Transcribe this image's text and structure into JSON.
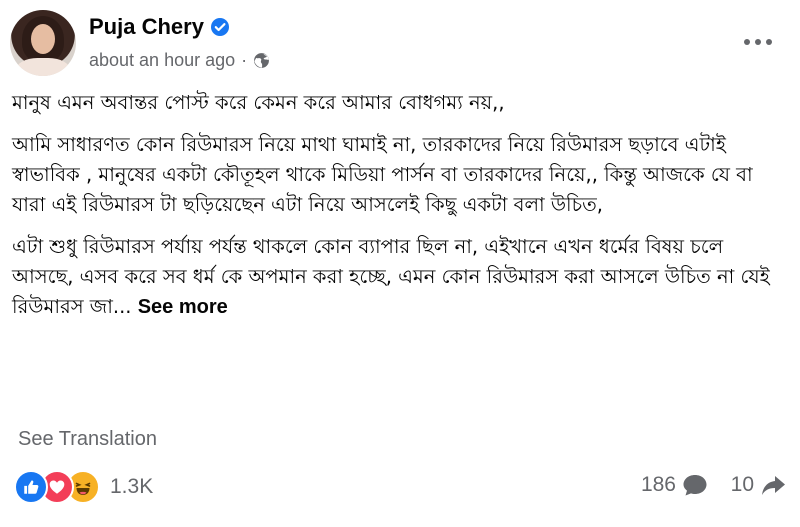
{
  "post": {
    "author": "Puja Chery",
    "timestamp": "about an hour ago",
    "separator": "·",
    "paragraphs": [
      "মানুষ এমন অবান্তর পোস্ট করে কেমন করে আমার বোধগম্য নয়,,",
      "আমি সাধারণত কোন রিউমারস নিয়ে মাথা ঘামাই না, তারকাদের নিয়ে রিউমারস ছড়াবে এটাই স্বাভাবিক , মানুষের একটা কৌতূহল থাকে মিডিয়া পার্সন বা তারকাদের নিয়ে,, কিন্তু আজকে যে বা যারা এই রিউমারস টা ছড়িয়েছেন এটা নিয়ে আসলেই কিছু একটা বলা উচিত,"
    ],
    "truncated_paragraph": "এটা শুধু রিউমারস পর্যায় পর্যন্ত থাকলে কোন ব্যাপার ছিল না, এইখানে এখন ধর্মের বিষয় চলে আসছে, এসব করে সব ধর্ম কে অপমান করা হচ্ছে, এমন কোন রিউমারস করা আসলে উচিত না যেই রিউমারস জা...",
    "see_more": "See more",
    "see_translation": "See Translation"
  },
  "engagement": {
    "reactions_count": "1.3K",
    "comments_count": "186",
    "shares_count": "10",
    "reaction_icons": [
      "like-icon",
      "love-icon",
      "haha-icon"
    ]
  },
  "colors": {
    "like": "#1877f2",
    "love": "#f33e58",
    "haha": "#f7b125",
    "verified": "#1877f2",
    "secondary_text": "#65676b"
  }
}
